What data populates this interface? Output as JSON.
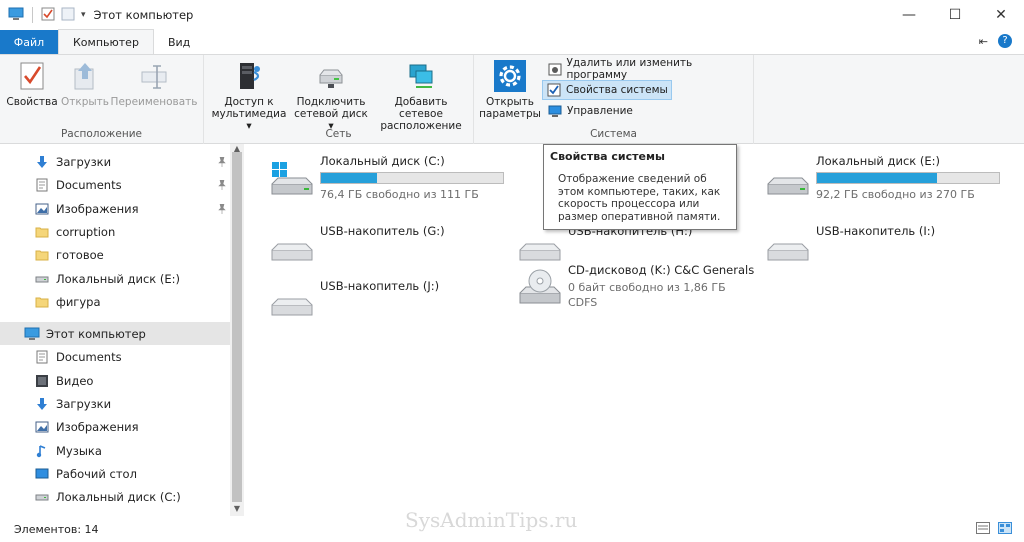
{
  "window": {
    "title": "Этот компьютер"
  },
  "tabs": {
    "file": "Файл",
    "computer": "Компьютер",
    "view": "Вид"
  },
  "ribbon": {
    "groups": {
      "location": "Расположение",
      "network": "Сеть",
      "system": "Система"
    },
    "properties": "Свойства",
    "open": "Открыть",
    "rename": "Переименовать",
    "media_access": [
      "Доступ к",
      "мультимедиа"
    ],
    "map_drive": [
      "Подключить",
      "сетевой диск"
    ],
    "add_location": [
      "Добавить сетевое",
      "расположение"
    ],
    "open_settings": [
      "Открыть",
      "параметры"
    ],
    "uninstall": "Удалить или изменить программу",
    "system_props": "Свойства системы",
    "manage": "Управление"
  },
  "tooltip": {
    "title": "Свойства системы",
    "body": "Отображение сведений об этом компьютере, таких, как скорость процессора или размер оперативной памяти."
  },
  "sidebar": {
    "items": [
      {
        "label": "Загрузки",
        "icon": "download-icon",
        "pinned": true
      },
      {
        "label": "Documents",
        "icon": "documents-icon",
        "pinned": true
      },
      {
        "label": "Изображения",
        "icon": "pictures-icon",
        "pinned": true
      },
      {
        "label": "corruption",
        "icon": "folder-icon",
        "pinned": false
      },
      {
        "label": "готовое",
        "icon": "folder-icon",
        "pinned": false
      },
      {
        "label": "Локальный диск (E:)",
        "icon": "drive-icon",
        "pinned": false
      },
      {
        "label": "фигура",
        "icon": "folder-icon",
        "pinned": false
      },
      {
        "label": "Этот компьютер",
        "icon": "computer-icon",
        "pinned": false
      },
      {
        "label": "Documents",
        "icon": "documents-icon",
        "pinned": false
      },
      {
        "label": "Видео",
        "icon": "video-icon",
        "pinned": false
      },
      {
        "label": "Загрузки",
        "icon": "download-icon",
        "pinned": false
      },
      {
        "label": "Изображения",
        "icon": "pictures-icon",
        "pinned": false
      },
      {
        "label": "Музыка",
        "icon": "music-icon",
        "pinned": false
      },
      {
        "label": "Рабочий стол",
        "icon": "desktop-icon",
        "pinned": false
      },
      {
        "label": "Локальный диск (C:)",
        "icon": "drive-icon",
        "pinned": false
      }
    ]
  },
  "drives": [
    {
      "name": "Локальный диск (C:)",
      "free": "76,4 ГБ свободно из 111 ГБ",
      "used_fraction": 0.31,
      "icon": "windows-drive-icon"
    },
    {
      "name": "Локальный диск (E:)",
      "free": "92,2 ГБ свободно из 270 ГБ",
      "used_fraction": 0.66,
      "icon": "drive-icon"
    },
    {
      "name": "USB-накопитель (G:)",
      "icon": "usb-drive-icon"
    },
    {
      "name": "USB-накопитель (H:)",
      "icon": "usb-drive-icon"
    },
    {
      "name": "USB-накопитель (I:)",
      "icon": "usb-drive-icon"
    },
    {
      "name": "USB-накопитель (J:)",
      "icon": "usb-drive-icon"
    },
    {
      "name": "CD-дисковод (K:) C&C Generals",
      "free": "0 байт свободно из 1,86 ГБ",
      "fs": "CDFS",
      "icon": "cd-drive-icon"
    }
  ],
  "status": {
    "items": "Элементов: 14"
  },
  "watermark": "SysAdminTips.ru"
}
